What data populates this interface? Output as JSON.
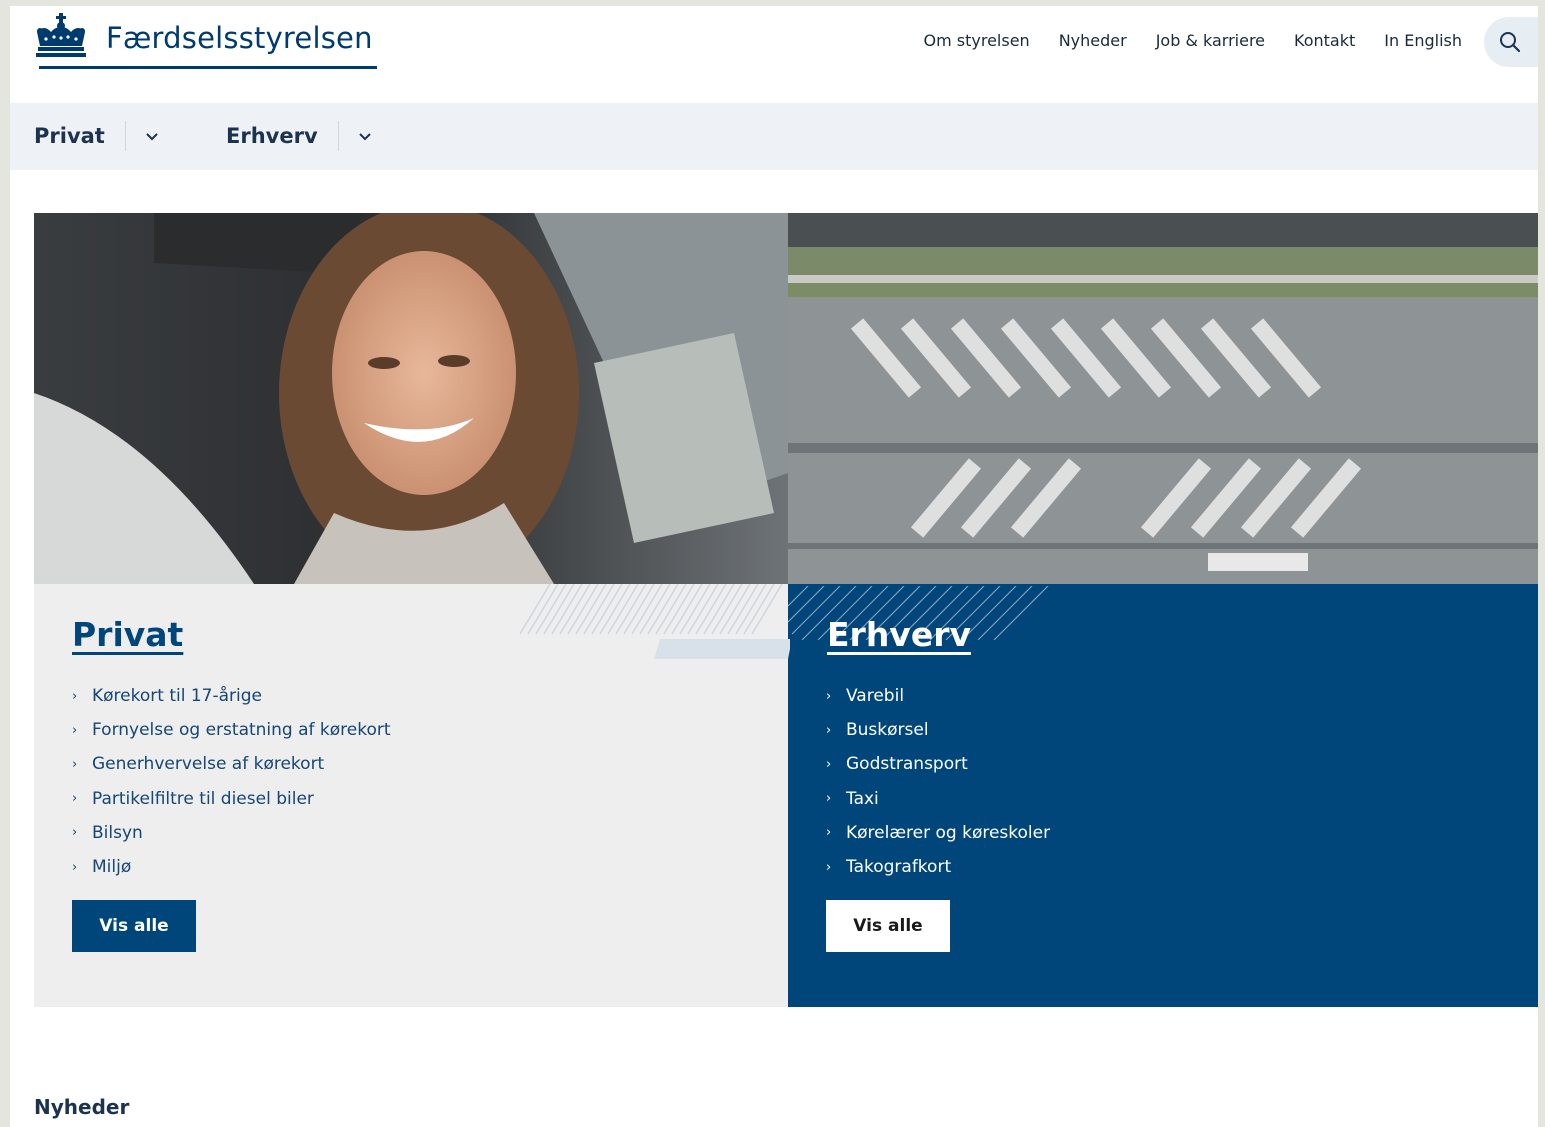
{
  "header": {
    "logo_text": "Færdselsstyrelsen",
    "nav": [
      "Om styrelsen",
      "Nyheder",
      "Job & karriere",
      "Kontakt",
      "In English"
    ]
  },
  "subnav": {
    "items": [
      {
        "label": "Privat"
      },
      {
        "label": "Erhverv"
      }
    ]
  },
  "privat": {
    "title": "Privat",
    "links": [
      "Kørekort til 17-årige",
      "Fornyelse og erstatning af kørekort",
      "Generhvervelse af kørekort",
      "Partikelfiltre til diesel biler",
      "Bilsyn",
      "Miljø"
    ],
    "button": "Vis alle"
  },
  "erhverv": {
    "title": "Erhverv",
    "links": [
      "Varebil",
      "Buskørsel",
      "Godstransport",
      "Taxi",
      "Kørelærer og køreskoler",
      "Takografkort"
    ],
    "button": "Vis alle"
  },
  "news": {
    "heading": "Nyheder"
  },
  "colors": {
    "brand_blue": "#01467a",
    "subnav_bg": "#eef2f6",
    "panel_grey": "#eeeeee"
  }
}
